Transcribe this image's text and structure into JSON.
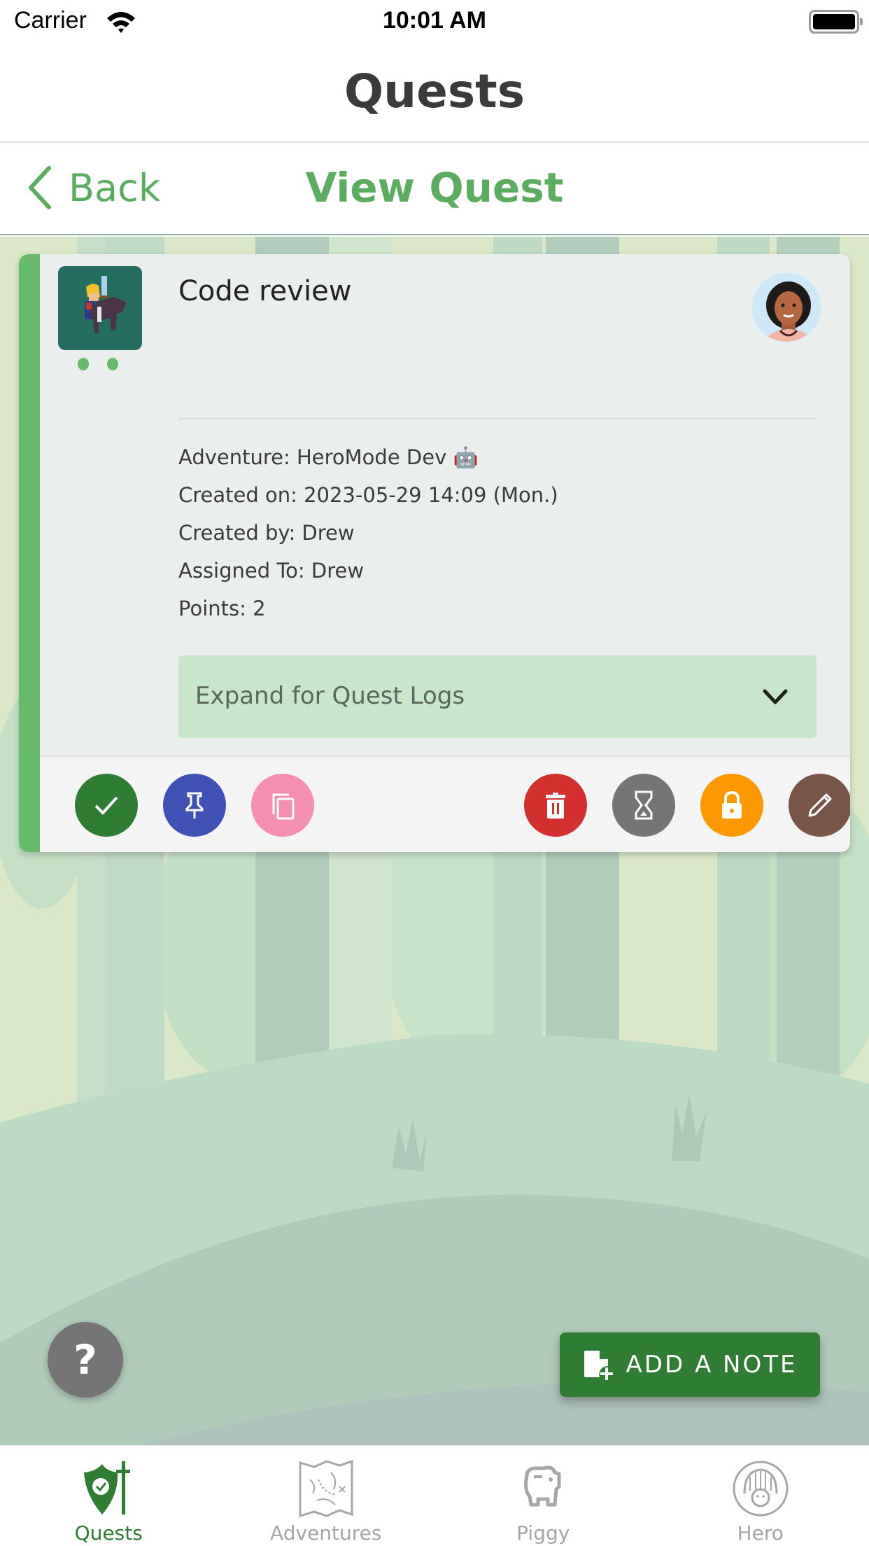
{
  "status_bar": {
    "carrier": "Carrier",
    "time": "10:01 AM"
  },
  "header": {
    "title": "Quests"
  },
  "sub_header": {
    "back_label": "Back",
    "title": "View Quest"
  },
  "quest": {
    "title": "Code review",
    "adventure": "Adventure: HeroMode Dev 🤖",
    "created_on": "Created on: 2023-05-29 14:09 (Mon.)",
    "created_by": "Created by: Drew",
    "assigned_to": "Assigned To: Drew",
    "points": "Points: 2",
    "expand_label": "Expand for Quest Logs",
    "accent_color": "#66bb6a"
  },
  "actions": [
    {
      "name": "complete",
      "icon": "check-icon",
      "color": "#2e7d32"
    },
    {
      "name": "pin",
      "icon": "pin-icon",
      "color": "#3f51b5"
    },
    {
      "name": "duplicate",
      "icon": "copy-icon",
      "color": "#f48fb1"
    },
    {
      "name": "delete",
      "icon": "trash-icon",
      "color": "#d32f2f"
    },
    {
      "name": "snooze",
      "icon": "hourglass-icon",
      "color": "#757575"
    },
    {
      "name": "lock",
      "icon": "lock-icon",
      "color": "#ff9800"
    },
    {
      "name": "edit",
      "icon": "pencil-icon",
      "color": "#795548"
    }
  ],
  "floating": {
    "help_label": "?",
    "add_note_label": "ADD A NOTE"
  },
  "tabs": [
    {
      "label": "Quests",
      "icon": "shield-sword-icon",
      "active": true
    },
    {
      "label": "Adventures",
      "icon": "map-icon",
      "active": false
    },
    {
      "label": "Piggy",
      "icon": "piggy-bank-icon",
      "active": false
    },
    {
      "label": "Hero",
      "icon": "knight-helmet-icon",
      "active": false
    }
  ]
}
